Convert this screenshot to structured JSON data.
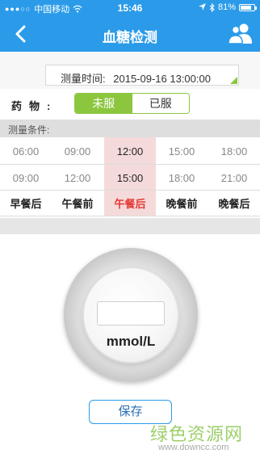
{
  "status_bar": {
    "carrier": "中国移动",
    "signal_dots": "●●●○○",
    "time": "15:46",
    "battery": "81%",
    "battery_level": 0.81
  },
  "nav": {
    "title": "血糖检测",
    "back_icon": "chevron-left-icon",
    "users_icon": "users-icon"
  },
  "measure_time": {
    "label": "测量时间:",
    "value": "2015-09-16  13:00:00"
  },
  "medicine": {
    "label": "药物:",
    "options": [
      "未服",
      "已服"
    ],
    "selected": "未服"
  },
  "conditions": {
    "header": "测量条件:",
    "columns": [
      {
        "t1": "06:00",
        "t2": "09:00",
        "name": "早餐后"
      },
      {
        "t1": "09:00",
        "t2": "12:00",
        "name": "午餐前"
      },
      {
        "t1": "12:00",
        "t2": "15:00",
        "name": "午餐后"
      },
      {
        "t1": "15:00",
        "t2": "18:00",
        "name": "晚餐前"
      },
      {
        "t1": "18:00",
        "t2": "21:00",
        "name": "晚餐后"
      }
    ],
    "selected_index": 2
  },
  "reading": {
    "value": "",
    "unit": "mmol/L"
  },
  "save_label": "保存",
  "watermark": {
    "text": "绿色资源网",
    "url": "www.downcc.com"
  },
  "colors": {
    "primary": "#2b9be9",
    "accent_green": "#8cc63f",
    "selected_red": "#e53935",
    "selected_bg": "#f4dada"
  }
}
